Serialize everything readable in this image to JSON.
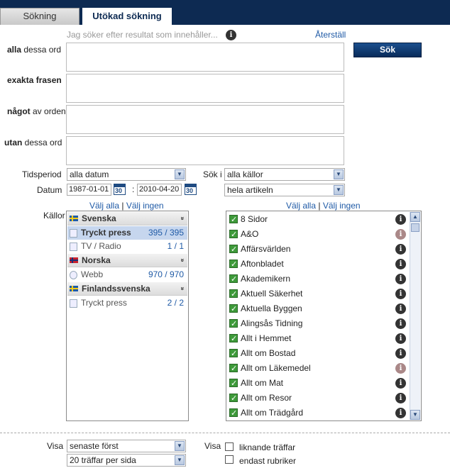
{
  "tabs": [
    {
      "label": "Sökning"
    },
    {
      "label": "Utökad sökning"
    }
  ],
  "hint": "Jag söker efter resultat som innehåller...",
  "reset": "Återställ",
  "search_button": "Sök",
  "fields": {
    "all_words": {
      "bold": "alla",
      "rest": " dessa ord",
      "value": ""
    },
    "exact_phrase": {
      "bold": "exakta frasen",
      "rest": "",
      "value": ""
    },
    "any_words": {
      "bold": "något",
      "rest": " av orden",
      "value": ""
    },
    "without_words": {
      "bold": "utan",
      "rest": " dessa ord",
      "value": ""
    }
  },
  "period": {
    "label": "Tidsperiod",
    "value": "alla datum"
  },
  "date": {
    "label": "Datum",
    "from": "1987-01-01",
    "sep": ":",
    "to": "2010-04-20",
    "cal": "30"
  },
  "search_in": {
    "label": "Sök i",
    "value": "alla källor",
    "scope": "hela artikeln"
  },
  "sources": {
    "label": "Källor",
    "select_all": "Välj alla",
    "pipe": "|",
    "select_none": "Välj ingen",
    "groups": [
      {
        "name": "Svenska",
        "rows": [
          {
            "name": "Tryckt press",
            "count": "395 / 395",
            "selected": true
          },
          {
            "name": "TV / Radio",
            "count": "1 / 1"
          }
        ]
      },
      {
        "name": "Norska",
        "rows": [
          {
            "name": "Webb",
            "count": "970 / 970"
          }
        ]
      },
      {
        "name": "Finlandssvenska",
        "rows": [
          {
            "name": "Tryckt press",
            "count": "2 / 2"
          }
        ]
      }
    ]
  },
  "publications": {
    "select_all": "Välj alla",
    "pipe": "|",
    "select_none": "Välj ingen",
    "items": [
      {
        "name": "8 Sidor",
        "checked": true,
        "muted": false
      },
      {
        "name": "A&O",
        "checked": true,
        "muted": true
      },
      {
        "name": "Affärsvärlden",
        "checked": true,
        "muted": false
      },
      {
        "name": "Aftonbladet",
        "checked": true,
        "muted": false
      },
      {
        "name": "Akademikern",
        "checked": true,
        "muted": false
      },
      {
        "name": "Aktuell Säkerhet",
        "checked": true,
        "muted": false
      },
      {
        "name": "Aktuella Byggen",
        "checked": true,
        "muted": false
      },
      {
        "name": "Alingsås Tidning",
        "checked": true,
        "muted": false
      },
      {
        "name": "Allt i Hemmet",
        "checked": true,
        "muted": false
      },
      {
        "name": "Allt om Bostad",
        "checked": true,
        "muted": false
      },
      {
        "name": "Allt om Läkemedel",
        "checked": true,
        "muted": true
      },
      {
        "name": "Allt om Mat",
        "checked": true,
        "muted": false
      },
      {
        "name": "Allt om Resor",
        "checked": true,
        "muted": false
      },
      {
        "name": "Allt om Trädgård",
        "checked": true,
        "muted": false
      }
    ]
  },
  "display": {
    "label": "Visa",
    "sort": "senaste först",
    "per_page": "20 träffar per sida",
    "label2": "Visa",
    "opt1": "liknande träffar",
    "opt2": "endast rubriker"
  },
  "icons": {
    "info": "i",
    "dropdown": "▼",
    "chevron": "»",
    "scroll_up": "▲",
    "scroll_down": "▼"
  }
}
